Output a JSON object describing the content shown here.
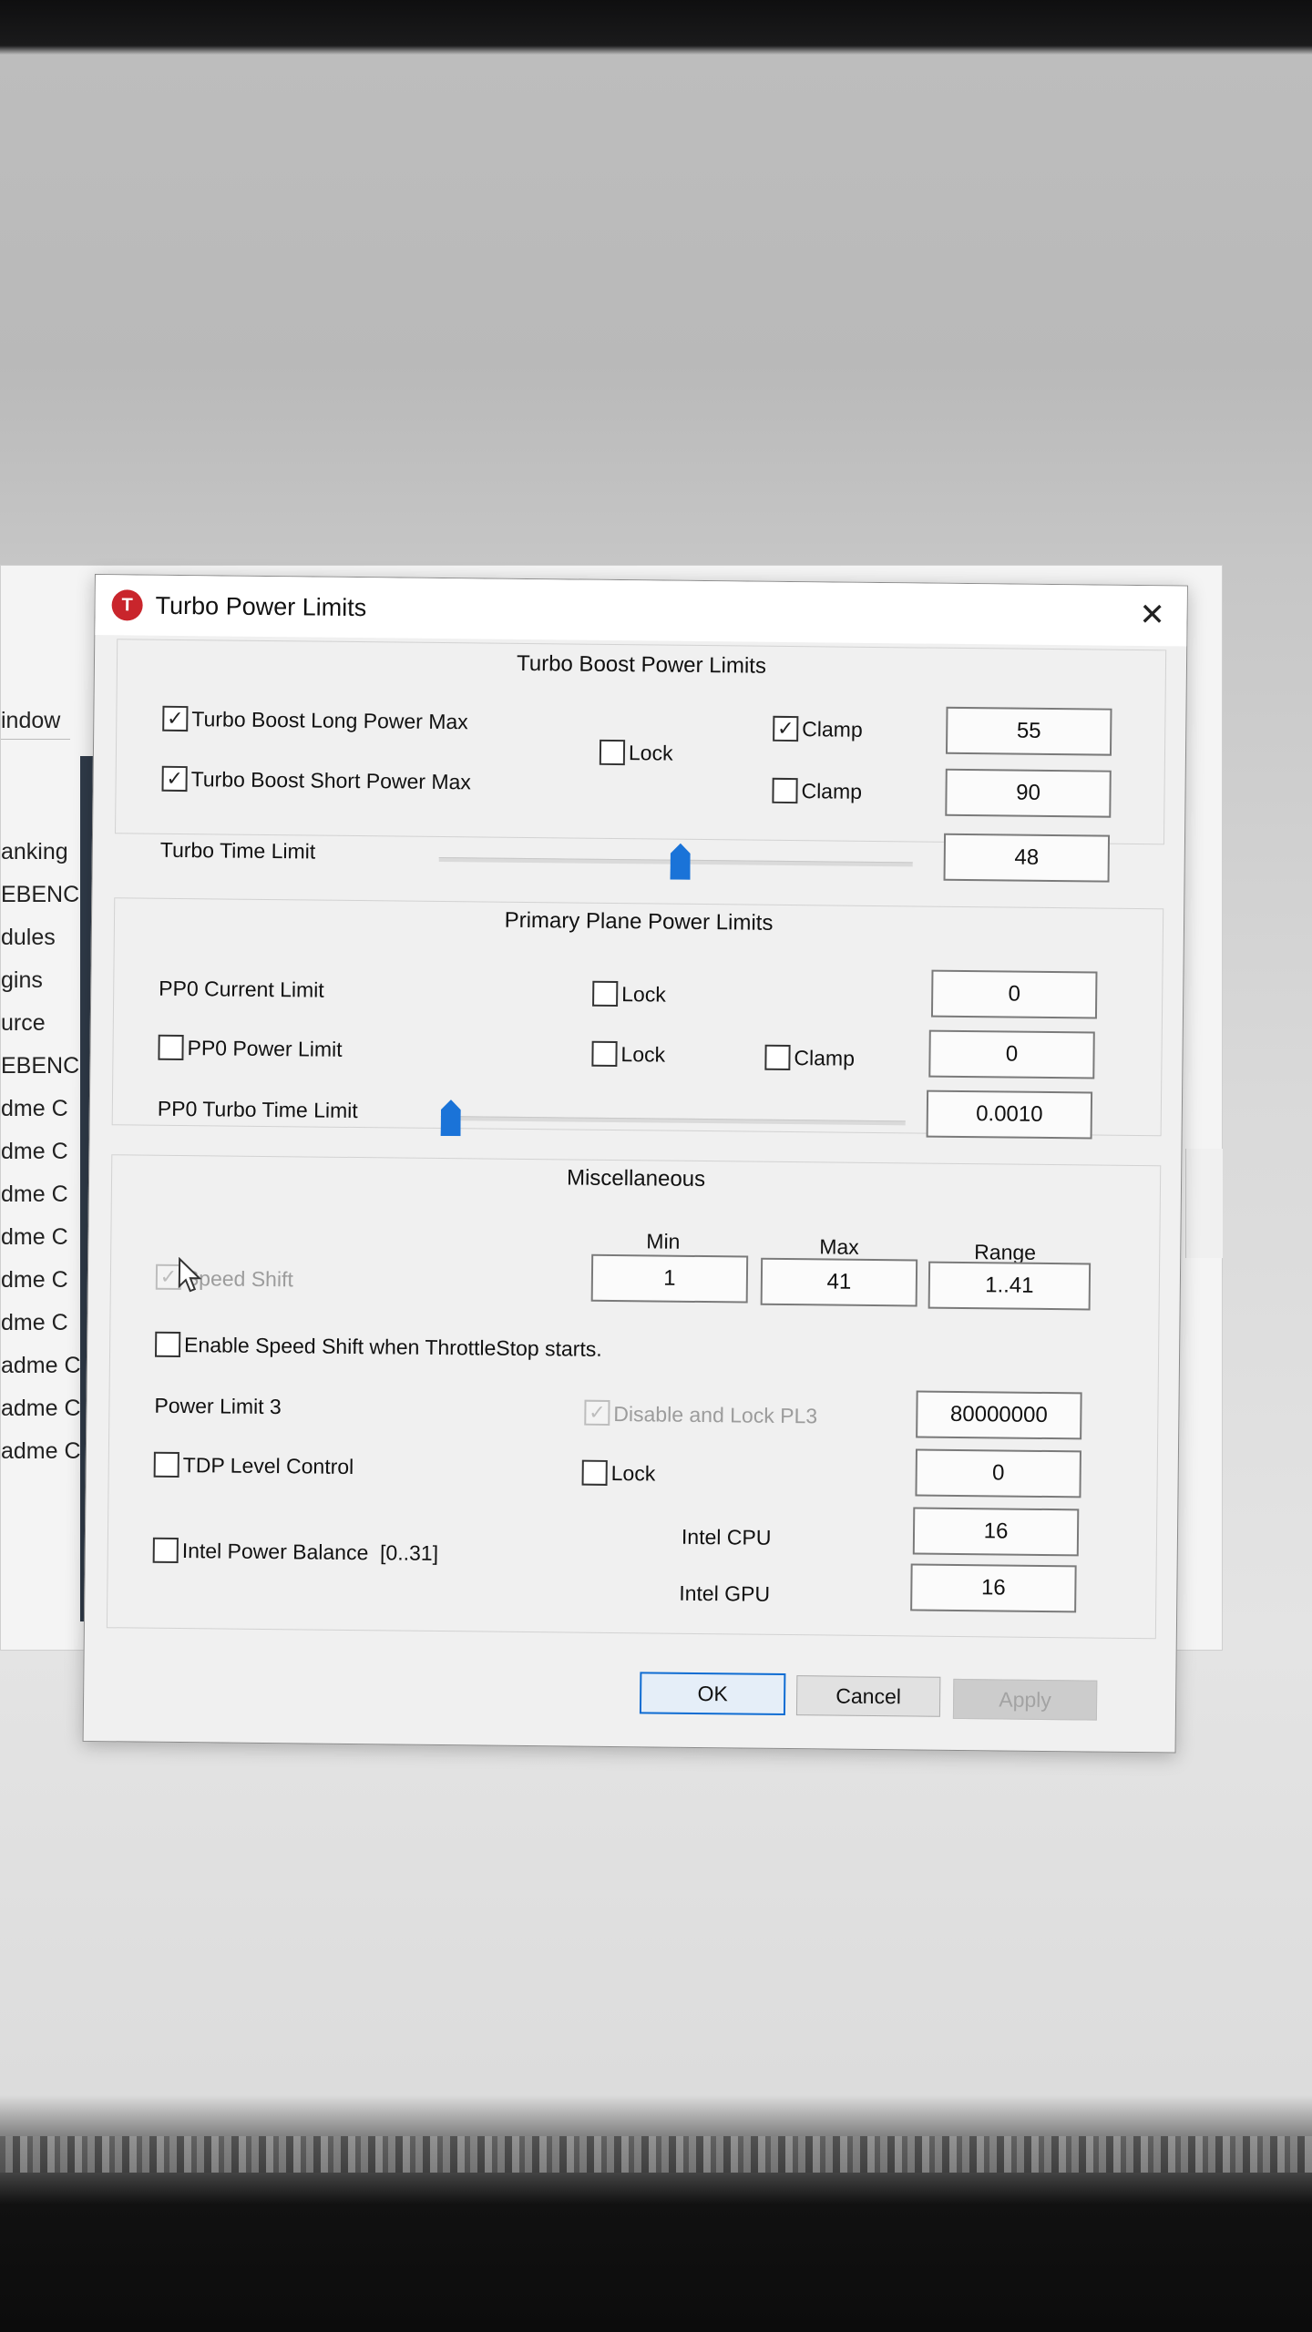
{
  "background_app": {
    "window_tab": "indow",
    "sidebar_items": [
      "anking",
      "EBENC",
      "dules",
      "gins",
      "urce",
      "EBENC",
      "dme C",
      "dme C",
      "dme C",
      "dme C",
      "dme C",
      "dme C",
      "adme C",
      "adme C",
      "adme C"
    ]
  },
  "dialog": {
    "title": "Turbo Power Limits",
    "close_glyph": "✕",
    "turbo_group": {
      "title": "Turbo Boost Power Limits",
      "long_label": "Turbo Boost Long Power Max",
      "short_label": "Turbo Boost Short Power Max",
      "lock_label": "Lock",
      "clamp_label": "Clamp",
      "time_label": "Turbo Time Limit",
      "long_value": "55",
      "short_value": "90",
      "time_value": "48",
      "time_slider_fraction": 0.51
    },
    "pp0_group": {
      "title": "Primary Plane Power Limits",
      "current_label": "PP0 Current Limit",
      "power_label": "PP0 Power Limit",
      "time_label": "PP0 Turbo Time Limit",
      "lock_label": "Lock",
      "clamp_label": "Clamp",
      "current_value": "0",
      "power_value": "0",
      "time_value": "0.0010",
      "time_slider_fraction": 0.0
    },
    "misc_group": {
      "title": "Miscellaneous",
      "min_header": "Min",
      "max_header": "Max",
      "range_header": "Range",
      "speed_shift_label": "Speed Shift",
      "min_value": "1",
      "max_value": "41",
      "range_value": "1..41",
      "enable_ss_label": "Enable Speed Shift when ThrottleStop starts.",
      "pl3_label": "Power Limit 3",
      "pl3_disable_label": "Disable and Lock PL3",
      "pl3_value": "80000000",
      "tdp_label": "TDP Level Control",
      "lock_label": "Lock",
      "tdp_value": "0",
      "ipb_label": "Intel Power Balance",
      "ipb_range": "[0..31]",
      "cpu_label": "Intel CPU",
      "gpu_label": "Intel GPU",
      "cpu_value": "16",
      "gpu_value": "16"
    },
    "buttons": {
      "ok": "OK",
      "cancel": "Cancel",
      "apply": "Apply"
    },
    "check_glyph": "✓"
  }
}
